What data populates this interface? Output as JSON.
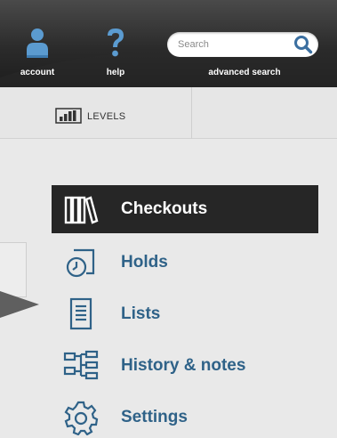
{
  "header": {
    "account_label": "account",
    "help_label": "help",
    "search_placeholder": "Search",
    "advanced_search_label": "advanced search",
    "colors": {
      "bar": "#2b2b2b",
      "text": "#ffffff",
      "account_icon": "#5b9bd0",
      "help_icon": "#5b9bd0",
      "search_icon": "#3b6fa0"
    },
    "icons": {
      "account": "user-icon",
      "help": "question-icon",
      "search": "search-icon"
    }
  },
  "levels": {
    "label": "LEVELS",
    "icon": "levels-bar-chart-icon"
  },
  "menu": {
    "active_color": "#262626",
    "link_color": "#2f6288",
    "items": [
      {
        "label": "Checkouts",
        "icon": "books-icon",
        "active": true
      },
      {
        "label": "Holds",
        "icon": "clock-tablet-icon",
        "active": false
      },
      {
        "label": "Lists",
        "icon": "list-icon",
        "active": false
      },
      {
        "label": "History & notes",
        "icon": "history-tree-icon",
        "active": false
      },
      {
        "label": "Settings",
        "icon": "gear-icon",
        "active": false
      }
    ]
  }
}
